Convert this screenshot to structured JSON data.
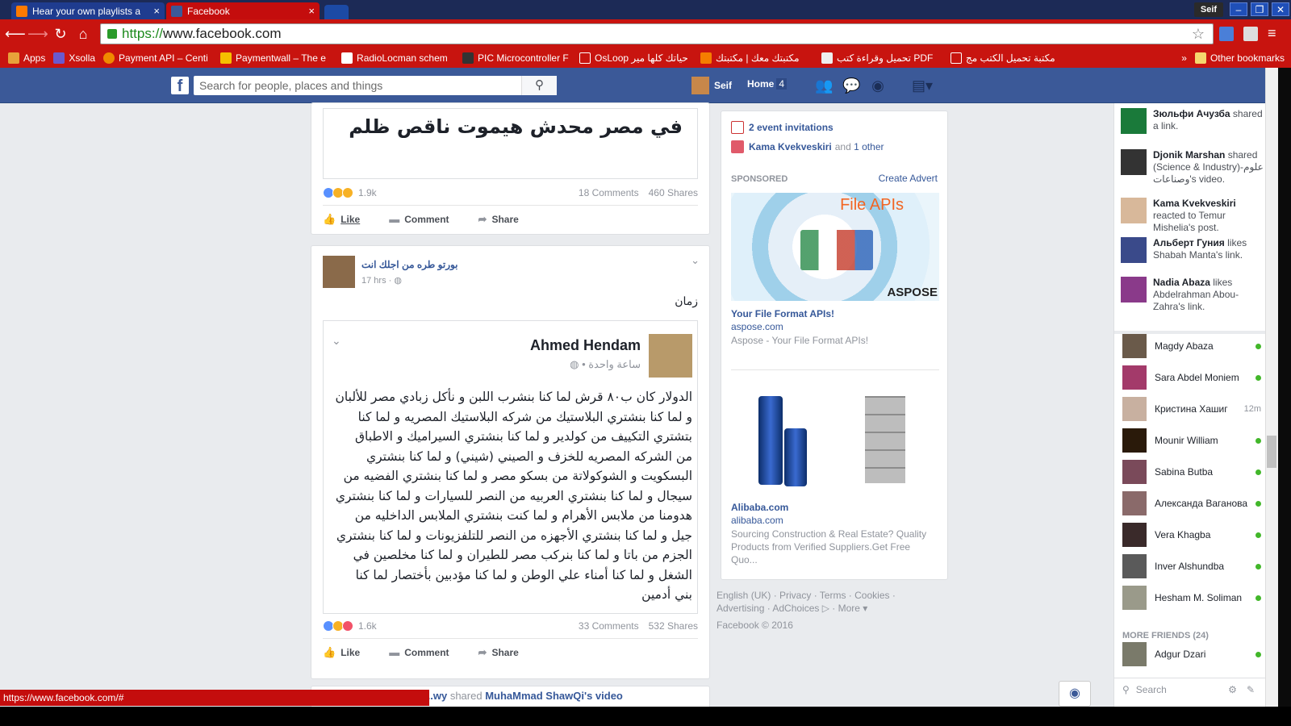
{
  "browser": {
    "tabs": [
      {
        "title": "Hear your own playlists a",
        "favicon_color": "#ff7a00"
      },
      {
        "title": "Facebook",
        "favicon_color": "#3b5998"
      }
    ],
    "user": "Seif",
    "url_scheme": "https://",
    "url_rest": "www.facebook.com",
    "bookmarks": [
      {
        "label": "Apps"
      },
      {
        "label": "Xsolla"
      },
      {
        "label": "Payment API – Centi"
      },
      {
        "label": "Paymentwall – The e"
      },
      {
        "label": "RadioLocman schem"
      },
      {
        "label": "PIC Microcontroller F"
      },
      {
        "label": "OsLoop حياتك كلها مير"
      },
      {
        "label": "مكتبتك معك | مكتبتك"
      },
      {
        "label": "تحميل وقراءة كتب PDF"
      },
      {
        "label": "مكتبة تحميل الكتب مج"
      }
    ],
    "other_bookmarks": "Other bookmarks",
    "status_url": "https://www.facebook.com/#"
  },
  "fb": {
    "search_placeholder": "Search for people, places and things",
    "user": "Seif",
    "home": "Home",
    "home_count": "4"
  },
  "feed": {
    "post1": {
      "quote": "في مصر محدش هيموت ناقص ظلم",
      "reactions": "1.9k",
      "comments": "18 Comments",
      "shares": "460 Shares"
    },
    "actions": {
      "like": "Like",
      "comment": "Comment",
      "share": "Share"
    },
    "post2": {
      "author": "بورتو طره من اجلك انت",
      "time": "17 hrs ·",
      "text": "زمان",
      "shared_author": "Ahmed Hendam",
      "shared_time": "ساعة واحدة •",
      "shared_body": "الدولار كان ب٨٠ قرش لما كنا بنشرب اللبن و نأكل زبادي مصر للألبان و لما كنا بنشتري البلاستيك من شركه البلاستيك المصريه و لما كنا بتشتري التكييف من كولدير و لما كنا بنشتري السيراميك و الاطباق من الشركه المصريه للخزف و الصيني (شيني) و لما كنا بنشتري البسكويت و الشوكولاتة من بسكو مصر و لما كنا بنشتري الفضيه من سيجال و لما كنا بنشتري العربيه من النصر للسيارات و لما كنا بنشتري هدومنا من ملابس الأهرام و لما كنت بنشتري الملابس الداخليه من جيل و لما كنا بنشتري الأجهزه من النصر للتلفزيونات و لما كنا بنشتري الجزم من باتا و لما كنا بنركب مصر للطيران و لما كنا مخلصين في الشغل و لما كنا أمناء علي الوطن و لما كنا مؤدبين بأختصار لما كنا بني أدمين",
      "reactions": "1.6k",
      "comments": "33 Comments",
      "shares": "532 Shares"
    },
    "post3_peek": {
      "actor": "...wy",
      "verb": "shared",
      "target": "MuhaMmad ShawQi's video"
    }
  },
  "right": {
    "events": "2 event invitations",
    "bday_name": "Kama Kvekveskiri",
    "bday_rest": "and",
    "bday_other": "1 other",
    "sponsored": "SPONSORED",
    "create_advert": "Create Advert",
    "ad1": {
      "image_title": "File APIs",
      "image_logo": "ASPOSE",
      "title": "Your File Format APIs!",
      "domain": "aspose.com",
      "desc": "Aspose - Your File Format APIs!"
    },
    "ad2": {
      "title": "Alibaba.com",
      "domain": "alibaba.com",
      "desc": "Sourcing Construction & Real Estate? Quality Products from Verified Suppliers.Get Free Quo..."
    },
    "footer_line1": "English (UK) · Privacy · Terms · Cookies ·",
    "footer_line2": "Advertising · AdChoices ▷ · More ▾",
    "copyright": "Facebook © 2016"
  },
  "ticker": [
    {
      "name": "Зюльфи Ачузба",
      "action": "shared a link."
    },
    {
      "name": "Djonik Marshan",
      "action": "shared (Science & Industry)-علوم وصناعات's video."
    },
    {
      "name": "Kama Kvekveskiri",
      "action": "reacted to Temur Mishelia's post."
    },
    {
      "name": "Альберт Гуния",
      "action": "likes Shabah Manta's link."
    },
    {
      "name": "Nadia Abaza",
      "action": "likes Abdelrahman Abou-Zahra's link."
    }
  ],
  "friends": [
    {
      "name": "Magdy Abaza",
      "status": "online"
    },
    {
      "name": "Sara Abdel Moniem",
      "status": "online"
    },
    {
      "name": "Кристина Хашиг",
      "status": "12m"
    },
    {
      "name": "Mounir William",
      "status": "online"
    },
    {
      "name": "Sabina Butba",
      "status": "online"
    },
    {
      "name": "Александа Ваганова",
      "status": "online"
    },
    {
      "name": "Vera Khagba",
      "status": "online"
    },
    {
      "name": "Inver Alshundba",
      "status": "online"
    },
    {
      "name": "Hesham M. Soliman",
      "status": "online"
    }
  ],
  "more_friends": "MORE FRIENDS (24)",
  "more_friend": {
    "name": "Adgur Dzari",
    "status": "online"
  },
  "chat_search": "Search"
}
